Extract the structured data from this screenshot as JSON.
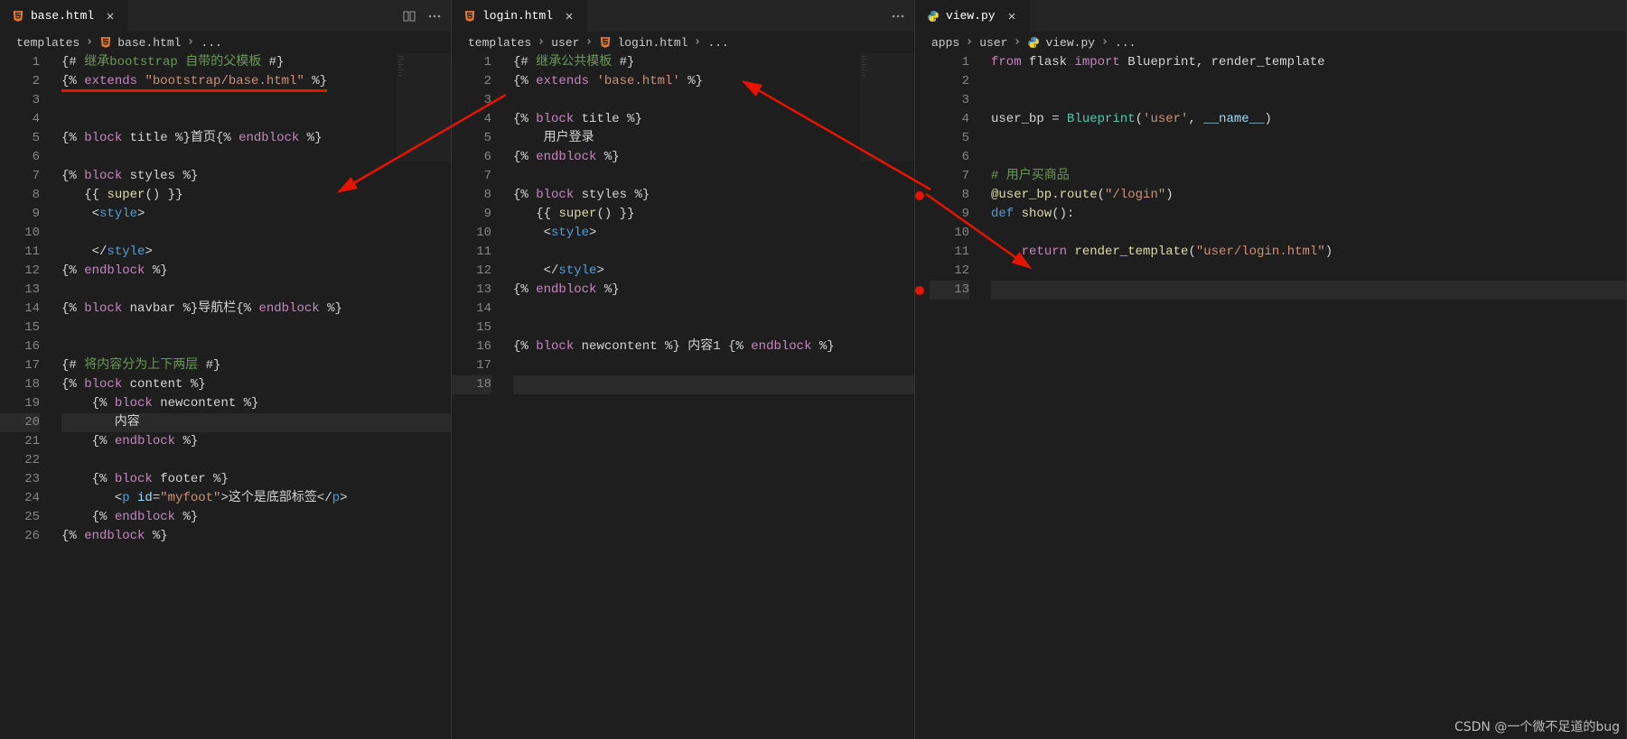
{
  "watermark": "CSDN @一个微不足道的bug",
  "panes": [
    {
      "tab": {
        "filename": "base.html",
        "icon": "html-icon"
      },
      "actions": [
        "split-icon",
        "more-icon"
      ],
      "breadcrumbs": [
        "templates",
        "base.html",
        "..."
      ],
      "breadcrumb_icons": [
        null,
        "html-icon",
        null
      ],
      "lines": [
        {
          "n": 1,
          "seg": [
            [
              "c-tmpl",
              "{# "
            ],
            [
              "c-comment",
              "继承bootstrap 自带的父模板"
            ],
            [
              "c-tmpl",
              " #}"
            ]
          ]
        },
        {
          "n": 2,
          "seg": [
            [
              "c-tmpl",
              "{% "
            ],
            [
              "c-keyword2",
              "extends"
            ],
            [
              "c-tmpl",
              " "
            ],
            [
              "c-string",
              "\"bootstrap/base.html\""
            ],
            [
              "c-tmpl",
              " %}"
            ]
          ],
          "underline": true
        },
        {
          "n": 3,
          "seg": []
        },
        {
          "n": 4,
          "seg": []
        },
        {
          "n": 5,
          "seg": [
            [
              "c-tmpl",
              "{% "
            ],
            [
              "c-keyword2",
              "block"
            ],
            [
              "c-tmpl",
              " title %}首页{% "
            ],
            [
              "c-keyword2",
              "endblock"
            ],
            [
              "c-tmpl",
              " %}"
            ]
          ]
        },
        {
          "n": 6,
          "seg": []
        },
        {
          "n": 7,
          "seg": [
            [
              "c-tmpl",
              "{% "
            ],
            [
              "c-keyword2",
              "block"
            ],
            [
              "c-tmpl",
              " styles %}"
            ]
          ]
        },
        {
          "n": 8,
          "seg": [
            [
              "c-white",
              "   "
            ],
            [
              "c-tmpl",
              "{{ "
            ],
            [
              "c-func",
              "super"
            ],
            [
              "c-white",
              "()"
            ],
            [
              "c-tmpl",
              " }}"
            ]
          ]
        },
        {
          "n": 9,
          "seg": [
            [
              "c-white",
              "    <"
            ],
            [
              "c-tag",
              "style"
            ],
            [
              "c-white",
              ">"
            ]
          ]
        },
        {
          "n": 10,
          "seg": []
        },
        {
          "n": 11,
          "seg": [
            [
              "c-white",
              "    </"
            ],
            [
              "c-tag",
              "style"
            ],
            [
              "c-white",
              ">"
            ]
          ]
        },
        {
          "n": 12,
          "seg": [
            [
              "c-tmpl",
              "{% "
            ],
            [
              "c-keyword2",
              "endblock"
            ],
            [
              "c-tmpl",
              " %}"
            ]
          ]
        },
        {
          "n": 13,
          "seg": []
        },
        {
          "n": 14,
          "seg": [
            [
              "c-tmpl",
              "{% "
            ],
            [
              "c-keyword2",
              "block"
            ],
            [
              "c-tmpl",
              " navbar %}导航栏{% "
            ],
            [
              "c-keyword2",
              "endblock"
            ],
            [
              "c-tmpl",
              " %}"
            ]
          ]
        },
        {
          "n": 15,
          "seg": []
        },
        {
          "n": 16,
          "seg": []
        },
        {
          "n": 17,
          "seg": [
            [
              "c-tmpl",
              "{# "
            ],
            [
              "c-comment",
              "将内容分为上下两层"
            ],
            [
              "c-tmpl",
              " #}"
            ]
          ]
        },
        {
          "n": 18,
          "seg": [
            [
              "c-tmpl",
              "{% "
            ],
            [
              "c-keyword2",
              "block"
            ],
            [
              "c-tmpl",
              " content %}"
            ]
          ]
        },
        {
          "n": 19,
          "seg": [
            [
              "c-white",
              "    "
            ],
            [
              "c-tmpl",
              "{% "
            ],
            [
              "c-keyword2",
              "block"
            ],
            [
              "c-tmpl",
              " newcontent %}"
            ]
          ]
        },
        {
          "n": 20,
          "seg": [
            [
              "c-white",
              "       内容"
            ]
          ],
          "cursor": true
        },
        {
          "n": 21,
          "seg": [
            [
              "c-white",
              "    "
            ],
            [
              "c-tmpl",
              "{% "
            ],
            [
              "c-keyword2",
              "endblock"
            ],
            [
              "c-tmpl",
              " %}"
            ]
          ]
        },
        {
          "n": 22,
          "seg": []
        },
        {
          "n": 23,
          "seg": [
            [
              "c-white",
              "    "
            ],
            [
              "c-tmpl",
              "{% "
            ],
            [
              "c-keyword2",
              "block"
            ],
            [
              "c-tmpl",
              " footer %}"
            ]
          ]
        },
        {
          "n": 24,
          "seg": [
            [
              "c-white",
              "       <"
            ],
            [
              "c-tag",
              "p"
            ],
            [
              "c-white",
              " "
            ],
            [
              "c-attr",
              "id"
            ],
            [
              "c-white",
              "="
            ],
            [
              "c-string",
              "\"myfoot\""
            ],
            [
              "c-white",
              ">这个是底部标签</"
            ],
            [
              "c-tag",
              "p"
            ],
            [
              "c-white",
              ">"
            ]
          ]
        },
        {
          "n": 25,
          "seg": [
            [
              "c-white",
              "    "
            ],
            [
              "c-tmpl",
              "{% "
            ],
            [
              "c-keyword2",
              "endblock"
            ],
            [
              "c-tmpl",
              " %}"
            ]
          ]
        },
        {
          "n": 26,
          "seg": [
            [
              "c-tmpl",
              "{% "
            ],
            [
              "c-keyword2",
              "endblock"
            ],
            [
              "c-tmpl",
              " %}"
            ]
          ]
        }
      ]
    },
    {
      "tab": {
        "filename": "login.html",
        "icon": "html-icon"
      },
      "actions": [
        "more-icon"
      ],
      "breadcrumbs": [
        "templates",
        "user",
        "login.html",
        "..."
      ],
      "breadcrumb_icons": [
        null,
        null,
        "html-icon",
        null
      ],
      "lines": [
        {
          "n": 1,
          "seg": [
            [
              "c-tmpl",
              "{# "
            ],
            [
              "c-comment",
              "继承公共模板"
            ],
            [
              "c-tmpl",
              " #}"
            ]
          ]
        },
        {
          "n": 2,
          "seg": [
            [
              "c-tmpl",
              "{% "
            ],
            [
              "c-keyword2",
              "extends"
            ],
            [
              "c-tmpl",
              " "
            ],
            [
              "c-string",
              "'base.html'"
            ],
            [
              "c-tmpl",
              " %}"
            ]
          ]
        },
        {
          "n": 3,
          "seg": []
        },
        {
          "n": 4,
          "seg": [
            [
              "c-tmpl",
              "{% "
            ],
            [
              "c-keyword2",
              "block"
            ],
            [
              "c-tmpl",
              " title %}"
            ]
          ]
        },
        {
          "n": 5,
          "seg": [
            [
              "c-white",
              "    用户登录"
            ]
          ]
        },
        {
          "n": 6,
          "seg": [
            [
              "c-tmpl",
              "{% "
            ],
            [
              "c-keyword2",
              "endblock"
            ],
            [
              "c-tmpl",
              " %}"
            ]
          ]
        },
        {
          "n": 7,
          "seg": []
        },
        {
          "n": 8,
          "seg": [
            [
              "c-tmpl",
              "{% "
            ],
            [
              "c-keyword2",
              "block"
            ],
            [
              "c-tmpl",
              " styles %}"
            ]
          ]
        },
        {
          "n": 9,
          "seg": [
            [
              "c-white",
              "   "
            ],
            [
              "c-tmpl",
              "{{ "
            ],
            [
              "c-func",
              "super"
            ],
            [
              "c-white",
              "()"
            ],
            [
              "c-tmpl",
              " }}"
            ]
          ]
        },
        {
          "n": 10,
          "seg": [
            [
              "c-white",
              "    <"
            ],
            [
              "c-tag",
              "style"
            ],
            [
              "c-white",
              ">"
            ]
          ]
        },
        {
          "n": 11,
          "seg": []
        },
        {
          "n": 12,
          "seg": [
            [
              "c-white",
              "    </"
            ],
            [
              "c-tag",
              "style"
            ],
            [
              "c-white",
              ">"
            ]
          ]
        },
        {
          "n": 13,
          "seg": [
            [
              "c-tmpl",
              "{% "
            ],
            [
              "c-keyword2",
              "endblock"
            ],
            [
              "c-tmpl",
              " %}"
            ]
          ]
        },
        {
          "n": 14,
          "seg": []
        },
        {
          "n": 15,
          "seg": []
        },
        {
          "n": 16,
          "seg": [
            [
              "c-tmpl",
              "{% "
            ],
            [
              "c-keyword2",
              "block"
            ],
            [
              "c-tmpl",
              " newcontent %} 内容1 {% "
            ],
            [
              "c-keyword2",
              "endblock"
            ],
            [
              "c-tmpl",
              " %}"
            ]
          ]
        },
        {
          "n": 17,
          "seg": []
        },
        {
          "n": 18,
          "seg": [],
          "cursor": true
        }
      ]
    },
    {
      "tab": {
        "filename": "view.py",
        "icon": "python-icon"
      },
      "actions": [],
      "breadcrumbs": [
        "apps",
        "user",
        "view.py",
        "..."
      ],
      "breadcrumb_icons": [
        null,
        null,
        "python-icon",
        null
      ],
      "breakpoints": [
        8,
        13
      ],
      "lines": [
        {
          "n": 1,
          "seg": [
            [
              "c-keyword2",
              "from"
            ],
            [
              "c-white",
              " flask "
            ],
            [
              "c-keyword2",
              "import"
            ],
            [
              "c-white",
              " Blueprint, render_template"
            ]
          ]
        },
        {
          "n": 2,
          "seg": []
        },
        {
          "n": 3,
          "seg": []
        },
        {
          "n": 4,
          "seg": [
            [
              "c-white",
              "user_bp = "
            ],
            [
              "c-class",
              "Blueprint"
            ],
            [
              "c-white",
              "("
            ],
            [
              "c-string",
              "'user'"
            ],
            [
              "c-white",
              ", "
            ],
            [
              "c-builtin",
              "__name__"
            ],
            [
              "c-white",
              ")"
            ]
          ]
        },
        {
          "n": 5,
          "seg": []
        },
        {
          "n": 6,
          "seg": []
        },
        {
          "n": 7,
          "seg": [
            [
              "c-comment",
              "# 用户买商品"
            ]
          ]
        },
        {
          "n": 8,
          "seg": [
            [
              "c-decorator",
              "@user_bp.route"
            ],
            [
              "c-white",
              "("
            ],
            [
              "c-string",
              "\"/login\""
            ],
            [
              "c-white",
              ")"
            ]
          ]
        },
        {
          "n": 9,
          "seg": [
            [
              "c-keyword",
              "def"
            ],
            [
              "c-white",
              " "
            ],
            [
              "c-func",
              "show"
            ],
            [
              "c-white",
              "():"
            ]
          ]
        },
        {
          "n": 10,
          "seg": []
        },
        {
          "n": 11,
          "seg": [
            [
              "c-white",
              "    "
            ],
            [
              "c-keyword2",
              "return"
            ],
            [
              "c-white",
              " "
            ],
            [
              "c-func",
              "render_template"
            ],
            [
              "c-white",
              "("
            ],
            [
              "c-string",
              "\"user/login.html\""
            ],
            [
              "c-white",
              ")"
            ]
          ]
        },
        {
          "n": 12,
          "seg": []
        },
        {
          "n": 13,
          "seg": [],
          "cursor": true
        }
      ]
    }
  ]
}
